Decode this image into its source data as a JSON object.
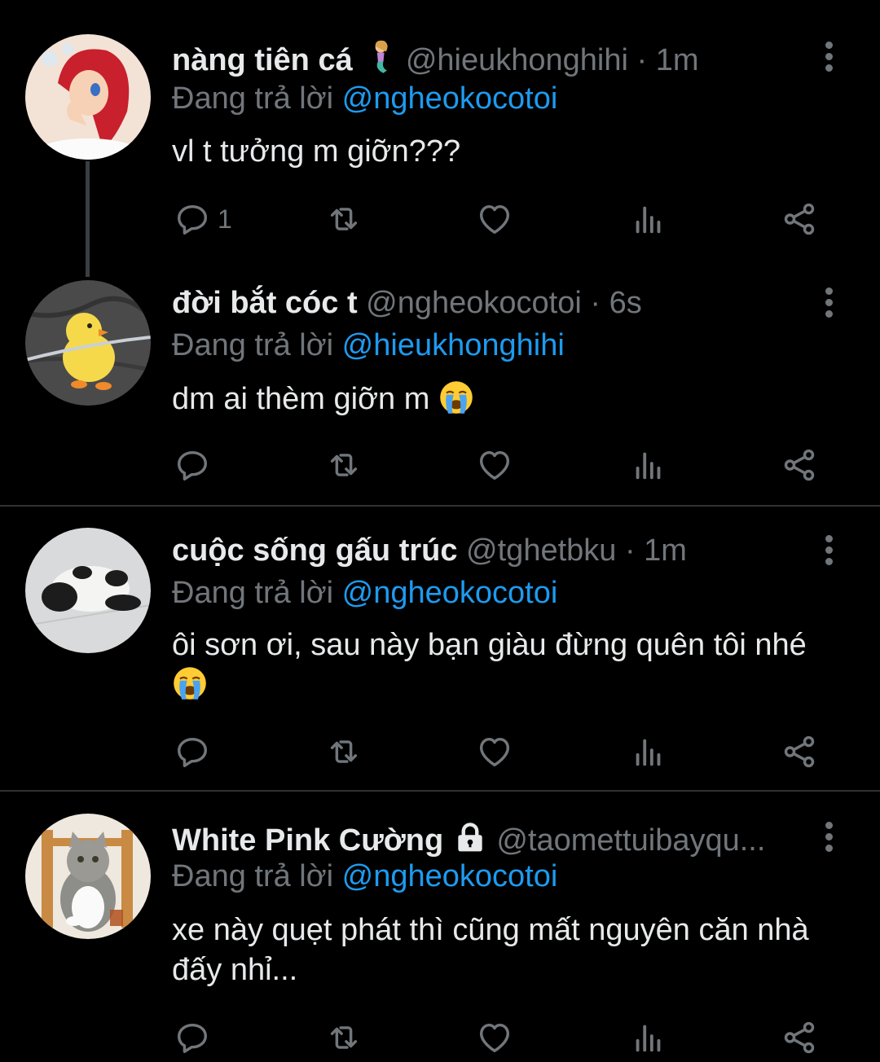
{
  "tweets": [
    {
      "name": "nàng tiên cá",
      "name_emoji": "mermaid-emoji",
      "handle": "@hieukhonghihi · 1m",
      "reply_prefix": "Đang trả lời ",
      "reply_to": "@ngheokocotoi",
      "text": "vl t tưởng m giỡn???",
      "reply_count": "1"
    },
    {
      "name": "đời bắt cóc t",
      "handle": "@ngheokocotoi · 6s",
      "reply_prefix": "Đang trả lời ",
      "reply_to": "@hieukhonghihi",
      "text": "dm ai thèm giỡn m",
      "text_emoji": "loudly-crying-face",
      "reply_count": ""
    },
    {
      "name": "cuộc sống gấu trúc",
      "handle": "@tghetbku · 1m",
      "reply_prefix": "Đang trả lời ",
      "reply_to": "@ngheokocotoi",
      "text": "ôi sơn ơi, sau này bạn giàu đừng quên tôi nhé",
      "text_emoji": "loudly-crying-face",
      "reply_count": ""
    },
    {
      "name": "White Pink Cường",
      "name_badge": "lock-icon",
      "handle": "@taomettuibayqu...",
      "reply_prefix": "Đang trả lời ",
      "reply_to": "@ngheokocotoi",
      "text": "xe này quẹt phát thì cũng mất nguyên căn nhà đấy nhỉ...",
      "reply_count": ""
    }
  ],
  "icons": {
    "reply": "reply-icon",
    "retweet": "retweet-icon",
    "like": "like-icon",
    "views": "views-icon",
    "share": "share-icon",
    "more": "more-options-icon"
  },
  "colors": {
    "background": "#000000",
    "text": "#e7e9ea",
    "muted": "#71767b",
    "link": "#1d9bf0",
    "separator": "#2f3336"
  }
}
